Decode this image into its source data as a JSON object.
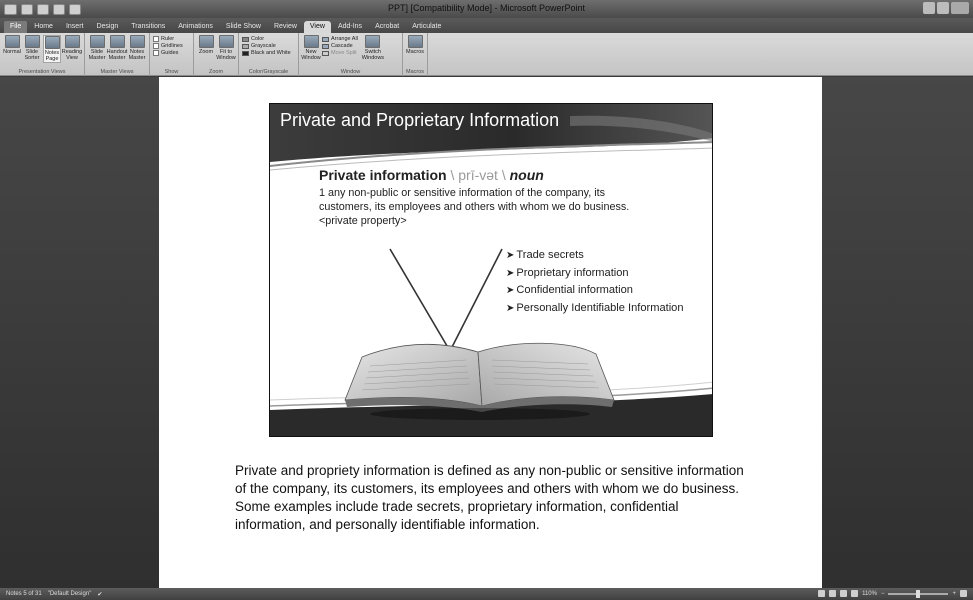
{
  "window": {
    "title": "PPT] [Compatibility Mode] - Microsoft PowerPoint"
  },
  "ribbon": {
    "tabs": [
      "File",
      "Home",
      "Insert",
      "Design",
      "Transitions",
      "Animations",
      "Slide Show",
      "Review",
      "View",
      "Add-Ins",
      "Acrobat",
      "Articulate"
    ],
    "active_tab": "View",
    "groups": {
      "presentation_views": {
        "label": "Presentation Views",
        "buttons": [
          "Normal",
          "Slide Sorter",
          "Notes Page",
          "Reading View"
        ]
      },
      "master_views": {
        "label": "Master Views",
        "buttons": [
          "Slide Master",
          "Handout Master",
          "Notes Master"
        ]
      },
      "show": {
        "label": "Show",
        "items": [
          "Ruler",
          "Gridlines",
          "Guides"
        ]
      },
      "zoom": {
        "label": "Zoom",
        "buttons": [
          "Zoom",
          "Fit to Window"
        ]
      },
      "color_grayscale": {
        "label": "Color/Grayscale",
        "items": [
          "Color",
          "Grayscale",
          "Black and White"
        ]
      },
      "window": {
        "label": "Window",
        "new_window": "New Window",
        "items": [
          "Arrange All",
          "Cascade",
          "Move Split"
        ],
        "switch": "Switch Windows"
      },
      "macros": {
        "label": "Macros",
        "button": "Macros"
      }
    }
  },
  "slide": {
    "title": "Private and Proprietary Information",
    "term": "Private information",
    "pronunciation": "\\ prī-vət \\",
    "part_of_speech": "noun",
    "definition": "1 any non-public or sensitive information of the company, its customers, its employees and others with whom we do business. <private property>",
    "bullets": [
      "Trade secrets",
      "Proprietary information",
      "Confidential information",
      "Personally Identifiable Information"
    ]
  },
  "notes": {
    "text": "Private and propriety information is defined as any non-public or sensitive information of the company, its customers, its employees and others with whom we do business.  Some examples include trade secrets, proprietary information, confidential information, and personally identifiable information."
  },
  "status": {
    "slide_count": "Notes 5 of 31",
    "theme": "\"Default Design\"",
    "zoom": "110%"
  }
}
